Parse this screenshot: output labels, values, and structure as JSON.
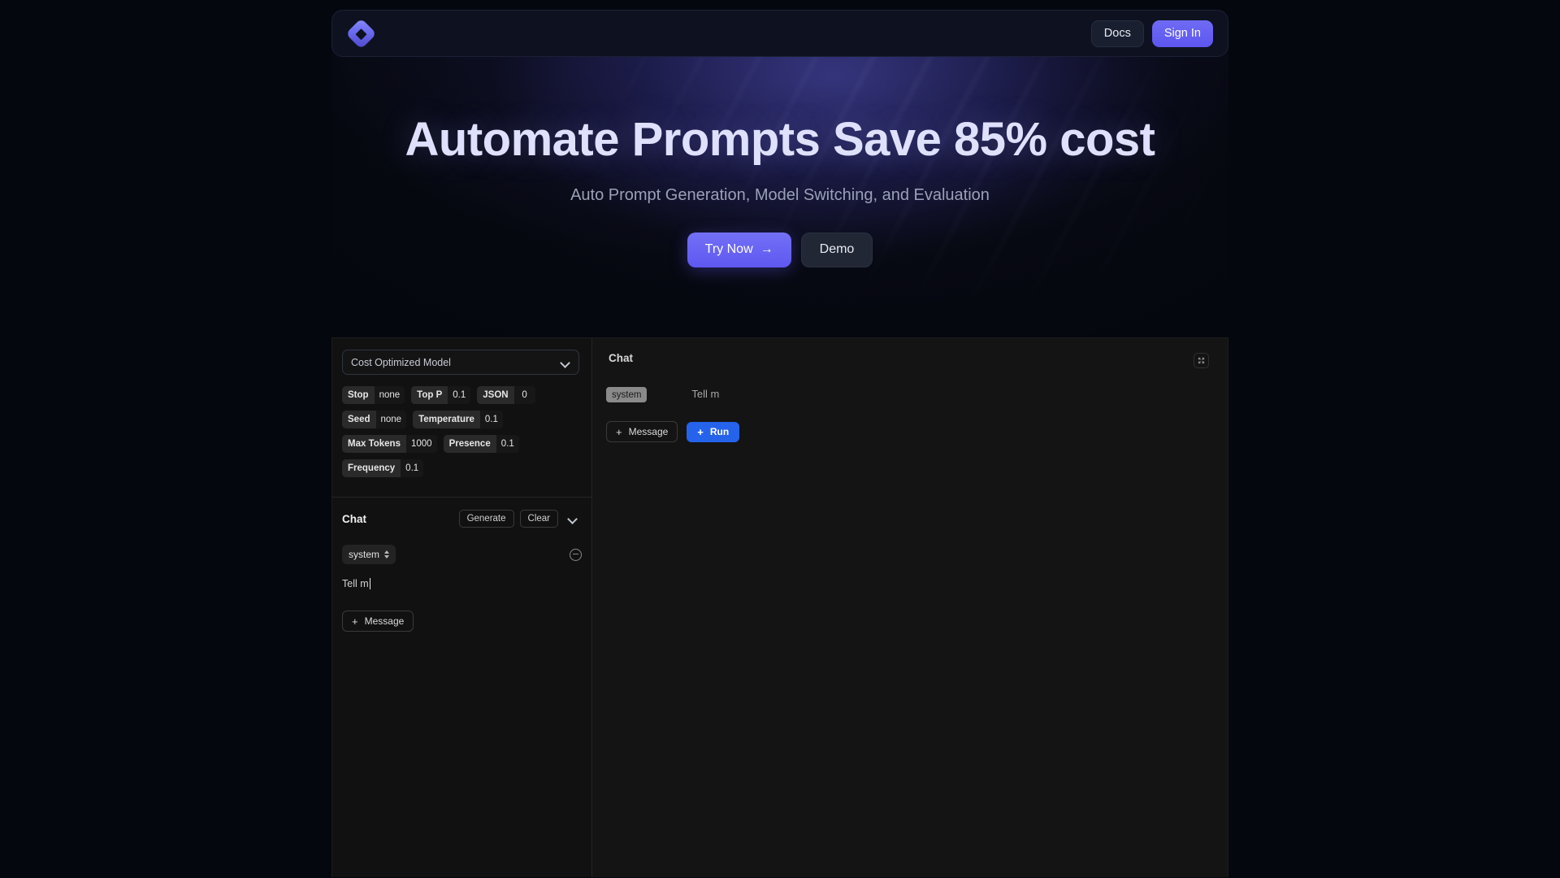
{
  "header": {
    "logo_icon": "diamond-logo-icon",
    "docs_label": "Docs",
    "signin_label": "Sign In"
  },
  "hero": {
    "title": "Automate Prompts Save 85% cost",
    "subtitle": "Auto Prompt Generation, Model Switching, and Evaluation",
    "primary_cta": "Try Now",
    "primary_cta_arrow": "→",
    "secondary_cta": "Demo"
  },
  "playground": {
    "left": {
      "model_select": {
        "value": "Cost Optimized Model",
        "chevron_icon": "chevron-down-icon"
      },
      "param_rows": [
        [
          {
            "key": "Stop",
            "value": "none"
          },
          {
            "key": "Top P",
            "value": "0.1"
          },
          {
            "key": "JSON",
            "value": "0"
          }
        ],
        [
          {
            "key": "Seed",
            "value": "none"
          },
          {
            "key": "Temperature",
            "value": "0.1"
          }
        ],
        [
          {
            "key": "Max Tokens",
            "value": "1000"
          },
          {
            "key": "Presence",
            "value": "0.1"
          }
        ],
        [
          {
            "key": "Frequency",
            "value": "0.1"
          }
        ]
      ],
      "chat": {
        "title": "Chat",
        "generate_label": "Generate",
        "clear_label": "Clear",
        "collapse_icon": "chevron-down-icon",
        "role": "system",
        "role_stepper_icon": "up-down-chevron-icon",
        "remove_icon": "minus-circle-icon",
        "message_text": "Tell m",
        "add_message_label": "Message",
        "add_message_plus": "+"
      }
    },
    "right": {
      "title": "Chat",
      "expand_icon": "expand-icon",
      "message": {
        "role": "system",
        "text": "Tell m"
      },
      "add_message_label": "Message",
      "add_message_plus": "+",
      "run_label": "Run",
      "run_plus": "+"
    }
  },
  "colors": {
    "accent_purple": "#5f58f0",
    "accent_blue": "#2563eb",
    "page_bg": "#05070f",
    "panel_bg": "#111111"
  }
}
